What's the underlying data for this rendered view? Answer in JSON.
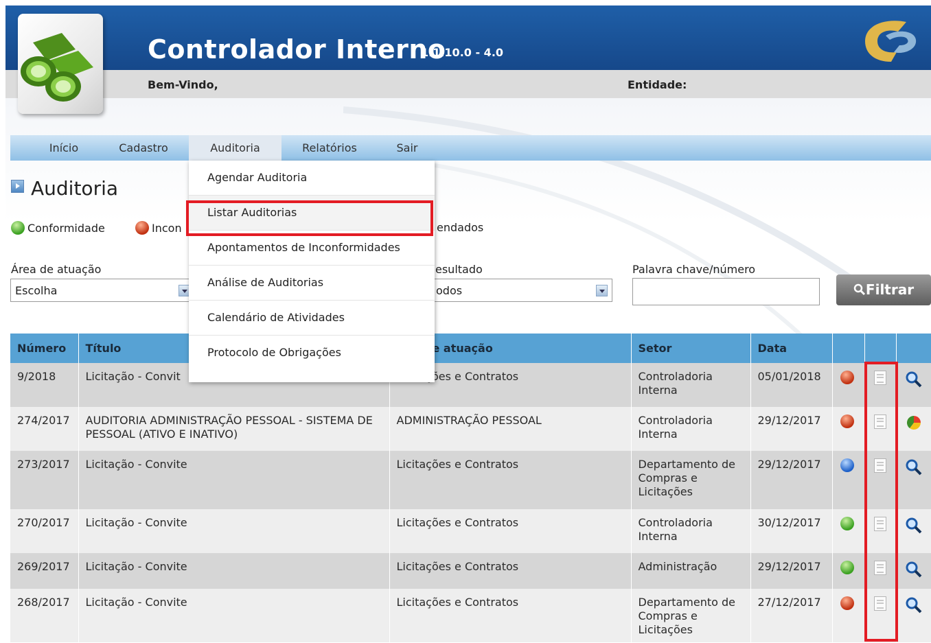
{
  "app": {
    "title": "Controlador Interno",
    "version": "1.1.10.0 - 4.0",
    "welcome": "Bem-Vindo,",
    "entity_label": "Entidade:"
  },
  "nav": {
    "items": [
      "Início",
      "Cadastro",
      "Auditoria",
      "Relatórios",
      "Sair"
    ],
    "active": "Auditoria"
  },
  "dropdown": {
    "items": [
      "Agendar Auditoria",
      "Listar Auditorias",
      "Apontamentos de Inconformidades",
      "Análise de Auditorias",
      "Calendário de Atividades",
      "Protocolo de Obrigações"
    ],
    "highlighted": "Listar Auditorias"
  },
  "page": {
    "title": "Auditoria"
  },
  "legend": {
    "conformidade": "Conformidade",
    "inconformidade_partial": "Incon",
    "agendados_partial": "endados"
  },
  "filters": {
    "area_label": "Área de atuação",
    "area_value": "Escolha",
    "resultado_label_partial": "esultado",
    "resultado_value_partial": "odos",
    "keyword_label": "Palavra chave/número",
    "keyword_value": "",
    "filter_button": "Filtrar"
  },
  "table": {
    "headers": {
      "numero": "Número",
      "titulo": "Título",
      "area_partial": "e atuação",
      "setor": "Setor",
      "data": "Data"
    },
    "rows": [
      {
        "numero": "9/2018",
        "titulo": "Licitação - Convit",
        "area": "Licitações e Contratos",
        "setor": "Controladoria Interna",
        "data": "05/01/2018",
        "status": "red",
        "action": "magnifier"
      },
      {
        "numero": "274/2017",
        "titulo": "AUDITORIA ADMINISTRAÇÃO PESSOAL - SISTEMA DE PESSOAL (ATIVO E INATIVO)",
        "area": "ADMINISTRAÇÃO PESSOAL",
        "setor": "Controladoria Interna",
        "data": "29/12/2017",
        "status": "red",
        "action": "chart"
      },
      {
        "numero": "273/2017",
        "titulo": "Licitação - Convite",
        "area": "Licitações e Contratos",
        "setor": "Departamento de Compras e Licitações",
        "data": "29/12/2017",
        "status": "blue",
        "action": "magnifier"
      },
      {
        "numero": "270/2017",
        "titulo": "Licitação - Convite",
        "area": "Licitações e Contratos",
        "setor": "Controladoria Interna",
        "data": "30/12/2017",
        "status": "green",
        "action": "magnifier"
      },
      {
        "numero": "269/2017",
        "titulo": "Licitação - Convite",
        "area": "Licitações e Contratos",
        "setor": "Administração",
        "data": "29/12/2017",
        "status": "green",
        "action": "magnifier"
      },
      {
        "numero": "268/2017",
        "titulo": "Licitação - Convite",
        "area": "Licitações e Contratos",
        "setor": "Departamento de Compras e Licitações",
        "data": "27/12/2017",
        "status": "red",
        "action": "magnifier"
      }
    ]
  },
  "colors": {
    "header_blue": "#1f5fa8",
    "nav_blue": "#8fc0e6",
    "table_header": "#57a2d4",
    "highlight_red": "#e31c24"
  }
}
